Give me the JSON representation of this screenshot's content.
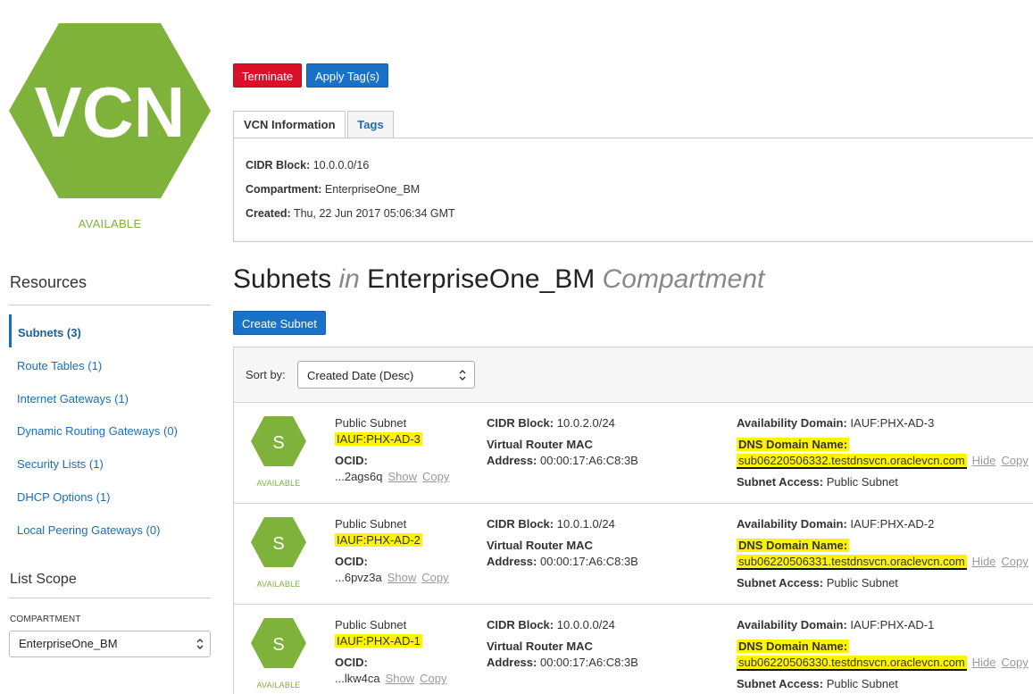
{
  "vcn": {
    "icon_text": "VCN",
    "state": "AVAILABLE",
    "colors": {
      "hex": "#7fb23a",
      "text": "#ffffff"
    }
  },
  "actions": {
    "terminate": "Terminate",
    "apply_tags": "Apply Tag(s)"
  },
  "tabs": {
    "info": "VCN Information",
    "tags": "Tags"
  },
  "info": {
    "cidr_label": "CIDR Block:",
    "cidr_value": "10.0.0.0/16",
    "compartment_label": "Compartment:",
    "compartment_value": "EnterpriseOne_BM",
    "created_label": "Created:",
    "created_value": "Thu, 22 Jun 2017 05:06:34 GMT"
  },
  "resources": {
    "title": "Resources",
    "items": [
      {
        "label": "Subnets (3)",
        "active": true
      },
      {
        "label": "Route Tables (1)"
      },
      {
        "label": "Internet Gateways (1)"
      },
      {
        "label": "Dynamic Routing Gateways (0)"
      },
      {
        "label": "Security Lists (1)"
      },
      {
        "label": "DHCP Options (1)"
      },
      {
        "label": "Local Peering Gateways (0)"
      }
    ]
  },
  "scope": {
    "title": "List Scope",
    "compartment_label": "COMPARTMENT",
    "compartment_value": "EnterpriseOne_BM"
  },
  "heading": {
    "a": "Subnets",
    "in": "in",
    "b": "EnterpriseOne_BM",
    "c": "Compartment"
  },
  "create_button": "Create Subnet",
  "sort": {
    "label": "Sort by:",
    "value": "Created Date (Desc)"
  },
  "subnet_labels": {
    "icon": "S",
    "state": "AVAILABLE",
    "ocid": "OCID:",
    "show": "Show",
    "copy": "Copy",
    "cidr": "CIDR Block:",
    "vr_mac": "Virtual Router MAC",
    "address": "Address:",
    "ad": "Availability Domain:",
    "dns": "DNS Domain Name:",
    "hide": "Hide",
    "access": "Subnet Access:"
  },
  "subnets": [
    {
      "name": "Public Subnet",
      "ad_tag": "IAUF:PHX-AD-3",
      "ocid": "...2ags6q",
      "cidr": "10.0.2.0/24",
      "mac": "00:00:17:A6:C8:3B",
      "ad": "IAUF:PHX-AD-3",
      "dns": "sub06220506332.testdnsvcn.oraclevcn.com",
      "access": "Public Subnet"
    },
    {
      "name": "Public Subnet",
      "ad_tag": "IAUF:PHX-AD-2",
      "ocid": "...6pvz3a",
      "cidr": "10.0.1.0/24",
      "mac": "00:00:17:A6:C8:3B",
      "ad": "IAUF:PHX-AD-2",
      "dns": "sub06220506331.testdnsvcn.oraclevcn.com",
      "access": "Public Subnet"
    },
    {
      "name": "Public Subnet",
      "ad_tag": "IAUF:PHX-AD-1",
      "ocid": "...lkw4ca",
      "cidr": "10.0.0.0/24",
      "mac": "00:00:17:A6:C8:3B",
      "ad": "IAUF:PHX-AD-1",
      "dns": "sub06220506330.testdnsvcn.oraclevcn.com",
      "access": "Public Subnet"
    }
  ],
  "highlight_color": "#fff400"
}
